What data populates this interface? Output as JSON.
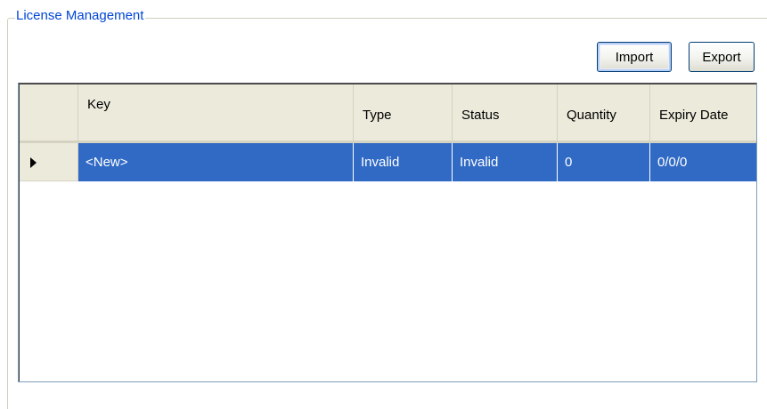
{
  "group": {
    "title": "License Management"
  },
  "toolbar": {
    "import_label": "Import",
    "export_label": "Export"
  },
  "grid": {
    "columns": [
      "Key",
      "Type",
      "Status",
      "Quantity",
      "Expiry Date"
    ],
    "rows": [
      {
        "key": "<New>",
        "type": "Invalid",
        "status": "Invalid",
        "quantity": "0",
        "expiry": "0/0/0",
        "selected": true
      }
    ],
    "row_indicator_icon": "current-row-arrow-icon"
  },
  "colors": {
    "title": "#0046D5",
    "selection": "#316AC5",
    "header_bg": "#EBEADB",
    "button_border": "#003C74"
  }
}
